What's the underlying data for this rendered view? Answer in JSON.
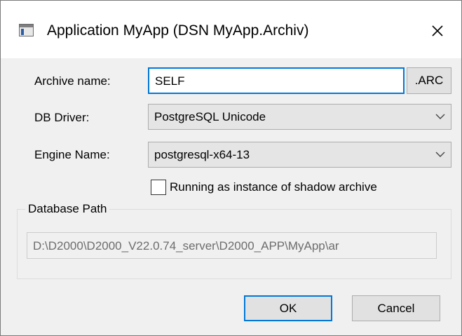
{
  "window": {
    "title": "Application MyApp (DSN MyApp.Archiv)"
  },
  "form": {
    "archive_name_label": "Archive name:",
    "archive_name_value": "SELF",
    "archive_ext_button": ".ARC",
    "db_driver_label": "DB Driver:",
    "db_driver_value": "PostgreSQL Unicode",
    "engine_name_label": "Engine Name:",
    "engine_name_value": "postgresql-x64-13",
    "shadow_checkbox_label": "Running as instance of shadow archive",
    "shadow_checkbox_checked": false
  },
  "database_path": {
    "group_label": "Database Path",
    "value": "D:\\D2000\\D2000_V22.0.74_server\\D2000_APP\\MyApp\\ar"
  },
  "buttons": {
    "ok": "OK",
    "cancel": "Cancel"
  },
  "colors": {
    "focus_accent": "#0078d7",
    "window_bg": "#f0f0f0"
  }
}
